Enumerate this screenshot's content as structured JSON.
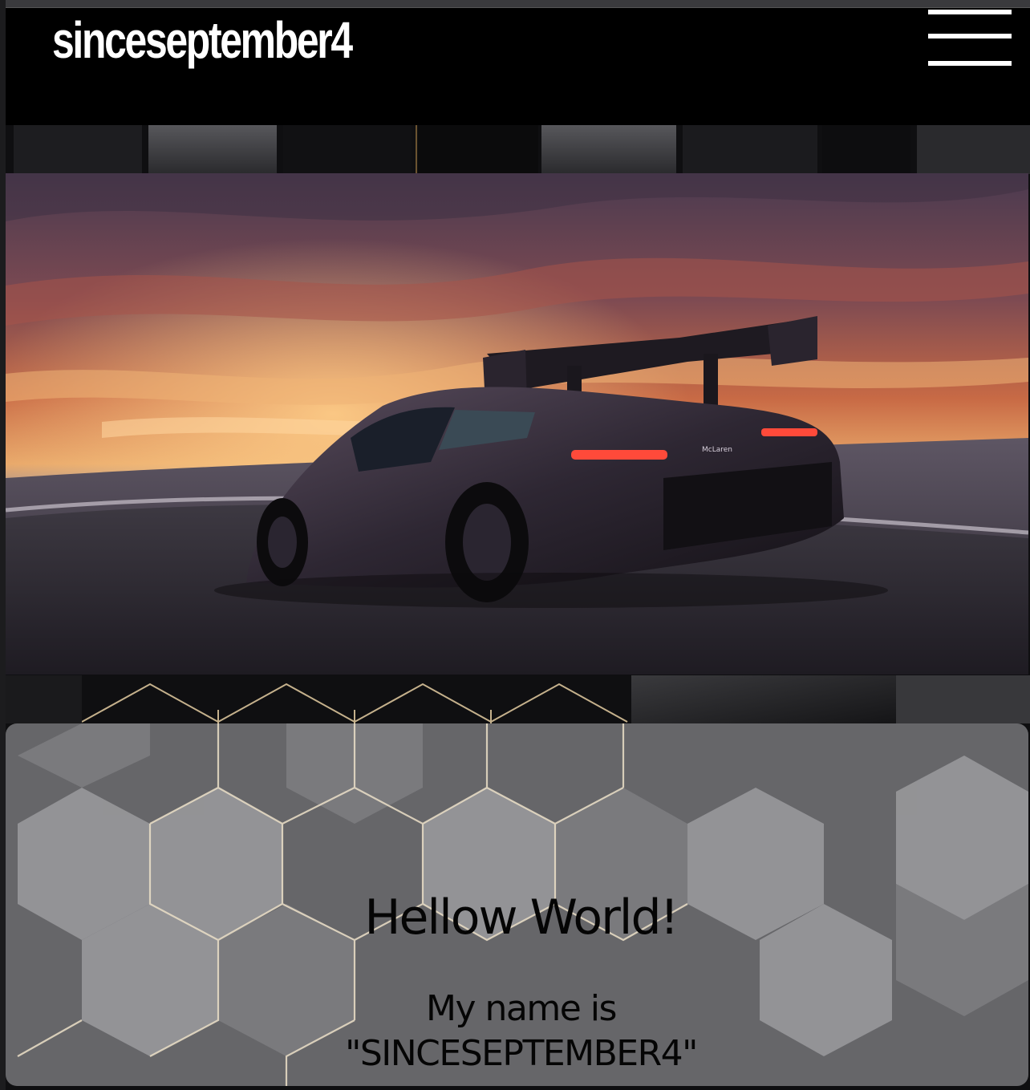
{
  "header": {
    "brand": "sinceseptember4",
    "menu_icon": "hamburger-menu-icon"
  },
  "hero": {
    "image_subject": "car",
    "badge_text": "McLaren"
  },
  "content": {
    "title": "Hellow World!",
    "line1": "My name is",
    "line2": "\"SINCESEPTEMBER4\""
  },
  "colors": {
    "header_bg": "#000000",
    "header_text": "#ffffff",
    "card_bg": "#a9a9ac",
    "hex_edge": "#e8d6b0"
  }
}
